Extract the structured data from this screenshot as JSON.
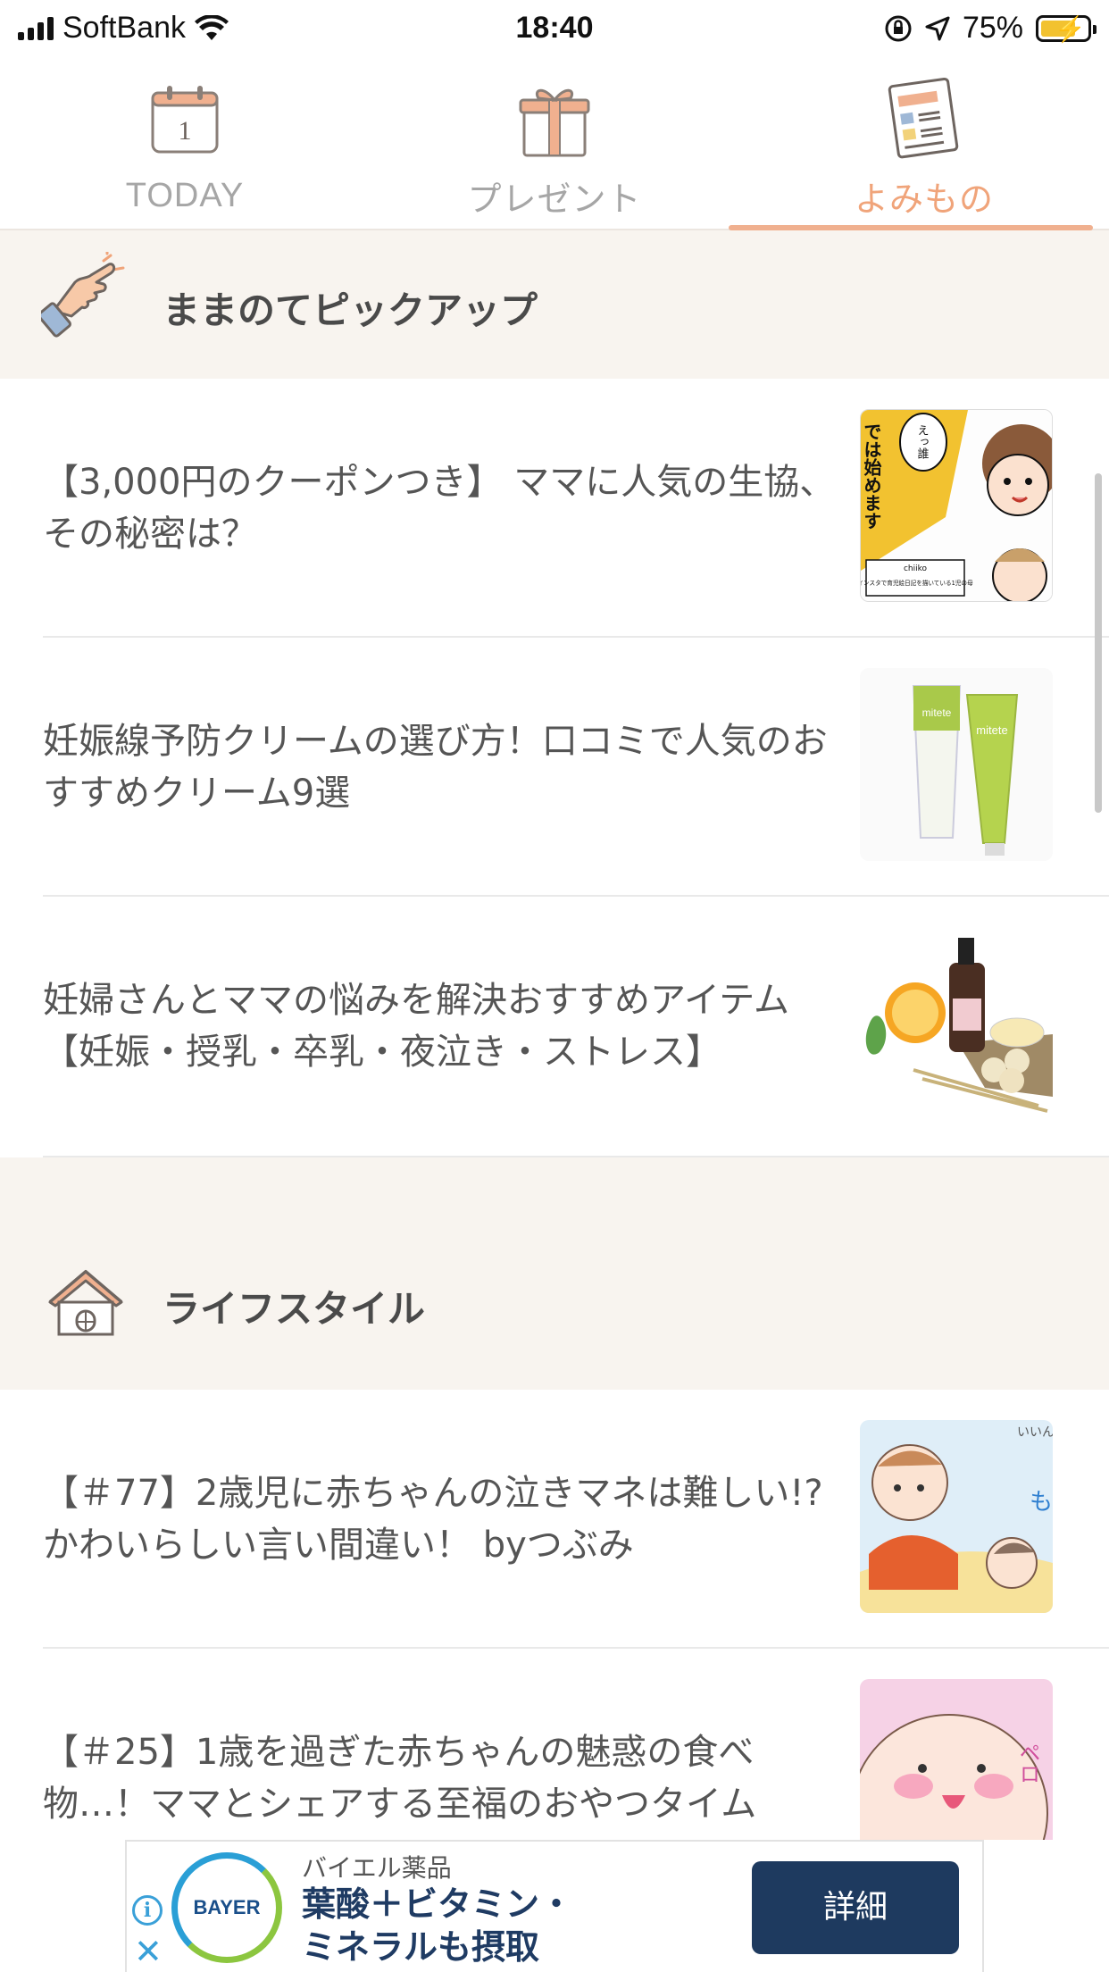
{
  "status_bar": {
    "carrier": "SoftBank",
    "time": "18:40",
    "battery_percent": "75%",
    "battery_level": 0.75
  },
  "tabs": [
    {
      "label": "TODAY",
      "icon": "calendar-icon",
      "calendar_day": "1"
    },
    {
      "label": "プレゼント",
      "icon": "gift-icon"
    },
    {
      "label": "よみもの",
      "icon": "newspaper-icon",
      "active": true
    }
  ],
  "sections": [
    {
      "title": "ままのてピックアップ",
      "icon": "pointing-hand-icon",
      "articles": [
        {
          "title": "【3,000円のクーポンつき】 ママに人気の生協、その秘密は？",
          "thumb_text": [
            "では始めます",
            "えっ誰",
            "chiiko",
            "インスタで育児絵日記を描いている1児の母"
          ]
        },
        {
          "title": "妊娠線予防クリームの選び方！口コミで人気のおすすめクリーム9選",
          "thumb_text": [
            "mitete",
            "mitete"
          ]
        },
        {
          "title": "妊婦さんとママの悩みを解決おすすめアイテム【妊娠・授乳・卒乳・夜泣き・ストレス】"
        }
      ]
    },
    {
      "title": "ライフスタイル",
      "icon": "house-icon",
      "articles": [
        {
          "title": "【＃77】2歳児に赤ちゃんの泣きマネは難しい!?かわいらしい言い間違い！ byつぶみ",
          "thumb_text": [
            "いいん",
            "も"
          ]
        },
        {
          "title": "【＃25】1歳を過ぎた赤ちゃんの魅惑の食べ物…！ママとシェアする至福のおやつタイム",
          "thumb_text": [
            "ペロ"
          ]
        }
      ]
    }
  ],
  "ad": {
    "logo_text": "BAYER",
    "brand": "バイエル薬品",
    "headline_1": "葉酸＋ビタミン・",
    "headline_2": "ミネラルも摂取",
    "button": "詳細",
    "info": "i",
    "close": "✕"
  }
}
